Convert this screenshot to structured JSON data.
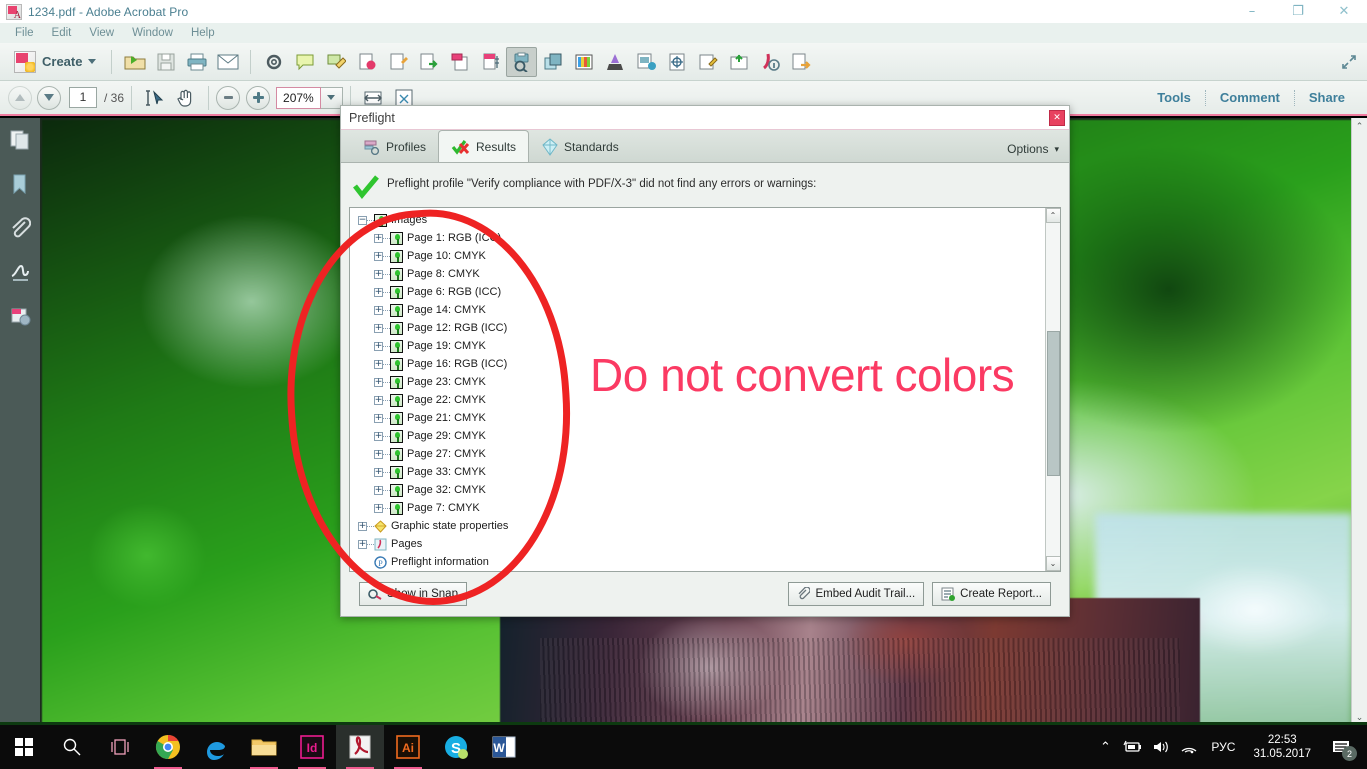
{
  "window": {
    "title": "1234.pdf - Adobe Acrobat Pro",
    "app_icon": "acrobat-icon",
    "minimize": "–",
    "restore": "❐",
    "close": "✕"
  },
  "menubar": {
    "items": [
      "File",
      "Edit",
      "View",
      "Window",
      "Help"
    ]
  },
  "toolbar": {
    "create_label": "Create",
    "create_caret": "▾",
    "icons": [
      "open-file-icon",
      "save-icon",
      "print-icon",
      "email-icon",
      "preferences-gear-icon",
      "sticky-note-icon",
      "highlight-text-icon",
      "attach-file-icon",
      "stamp-icon",
      "export-pdf-icon",
      "combine-files-icon",
      "page-thumbnails-icon",
      "optimize-pdf-icon",
      "preflight-icon",
      "layers-icon",
      "output-preview-icon",
      "ink-manager-icon",
      "print-production-icon",
      "trap-presets-icon",
      "edit-object-icon",
      "save-as-icon",
      "document-info-icon",
      "export-icon"
    ],
    "expand_icon": "expand-toolbar-icon"
  },
  "navbar": {
    "page_up": "page-up-icon",
    "page_down": "page-down-icon",
    "current_page": "1",
    "page_total": "/ 36",
    "select_tool": "select-text-icon",
    "hand_tool": "hand-icon",
    "zoom_out": "zoom-out-icon",
    "zoom_in": "zoom-in-icon",
    "zoom_level": "207%",
    "zoom_caret": "▾",
    "fit_width": "fit-width-icon",
    "fit_page": "fit-page-icon",
    "right_links": [
      "Tools",
      "Comment",
      "Share"
    ]
  },
  "leftrail": {
    "items": [
      "page-thumbnails-icon",
      "bookmarks-icon",
      "attachments-icon",
      "signatures-icon",
      "comments-icon"
    ]
  },
  "document": {
    "watermark_text": "Do not convert colors",
    "watermark_color": "#fb3a63",
    "annotation": "red-ellipse-annotation",
    "annotation_color": "#ee2323",
    "scroll_up": "⌃",
    "scroll_down": "⌄"
  },
  "dialog": {
    "title": "Preflight",
    "close_label": "✕",
    "tabs": [
      {
        "label": "Profiles",
        "icon": "profiles-icon",
        "selected": false
      },
      {
        "label": "Results",
        "icon": "results-check-icon",
        "selected": true
      },
      {
        "label": "Standards",
        "icon": "standards-icon",
        "selected": false
      }
    ],
    "options_label": "Options",
    "options_caret": "▾",
    "status_icon": "green-check-icon",
    "status_text": "Preflight profile \"Verify compliance with PDF/X-3\" did not find any errors or warnings:",
    "tree": [
      {
        "label": "Images",
        "indent": 0,
        "expander": "−",
        "icon": "image-icon"
      },
      {
        "label": "Page 1: RGB (ICC)",
        "indent": 1,
        "expander": "+",
        "icon": "image-icon"
      },
      {
        "label": "Page 10: CMYK",
        "indent": 1,
        "expander": "+",
        "icon": "image-icon"
      },
      {
        "label": "Page 8: CMYK",
        "indent": 1,
        "expander": "+",
        "icon": "image-icon"
      },
      {
        "label": "Page 6: RGB (ICC)",
        "indent": 1,
        "expander": "+",
        "icon": "image-icon"
      },
      {
        "label": "Page 14: CMYK",
        "indent": 1,
        "expander": "+",
        "icon": "image-icon"
      },
      {
        "label": "Page 12: RGB (ICC)",
        "indent": 1,
        "expander": "+",
        "icon": "image-icon"
      },
      {
        "label": "Page 19: CMYK",
        "indent": 1,
        "expander": "+",
        "icon": "image-icon"
      },
      {
        "label": "Page 16: RGB (ICC)",
        "indent": 1,
        "expander": "+",
        "icon": "image-icon"
      },
      {
        "label": "Page 23: CMYK",
        "indent": 1,
        "expander": "+",
        "icon": "image-icon"
      },
      {
        "label": "Page 22: CMYK",
        "indent": 1,
        "expander": "+",
        "icon": "image-icon"
      },
      {
        "label": "Page 21: CMYK",
        "indent": 1,
        "expander": "+",
        "icon": "image-icon"
      },
      {
        "label": "Page 29: CMYK",
        "indent": 1,
        "expander": "+",
        "icon": "image-icon"
      },
      {
        "label": "Page 27: CMYK",
        "indent": 1,
        "expander": "+",
        "icon": "image-icon"
      },
      {
        "label": "Page 33: CMYK",
        "indent": 1,
        "expander": "+",
        "icon": "image-icon"
      },
      {
        "label": "Page 32: CMYK",
        "indent": 1,
        "expander": "+",
        "icon": "image-icon"
      },
      {
        "label": "Page 7: CMYK",
        "indent": 1,
        "expander": "+",
        "icon": "image-icon"
      },
      {
        "label": "Graphic state properties",
        "indent": 0,
        "expander": "+",
        "icon": "graphic-state-icon"
      },
      {
        "label": "Pages",
        "indent": 0,
        "expander": "+",
        "icon": "pages-icon"
      },
      {
        "label": "Preflight information",
        "indent": 0,
        "expander": "",
        "icon": "preflight-info-icon"
      }
    ],
    "scroll_up": "⌃",
    "scroll_down": "⌄",
    "footer": {
      "snap_label": "Show in Snap",
      "snap_icon": "snap-icon",
      "embed_label": "Embed Audit Trail...",
      "embed_icon": "paperclip-icon",
      "report_label": "Create Report...",
      "report_icon": "report-icon"
    }
  },
  "taskbar": {
    "start_icon": "windows-start-icon",
    "search_icon": "search-icon",
    "taskview_icon": "task-view-icon",
    "apps": [
      {
        "name": "chrome-icon",
        "label": "Chrome",
        "active": false
      },
      {
        "name": "edge-icon",
        "label": "Edge",
        "active": false
      },
      {
        "name": "file-explorer-icon",
        "label": "File Explorer",
        "active": false
      },
      {
        "name": "indesign-icon",
        "label": "Id",
        "active": false
      },
      {
        "name": "acrobat-icon",
        "label": "Acrobat",
        "active": true
      },
      {
        "name": "illustrator-icon",
        "label": "Ai",
        "active": false
      },
      {
        "name": "skype-icon",
        "label": "Skype",
        "active": false
      },
      {
        "name": "word-icon",
        "label": "W",
        "active": false
      }
    ],
    "tray": {
      "chevron": "⌃",
      "battery_icon": "battery-icon",
      "volume_icon": "volume-icon",
      "wifi_icon": "wifi-icon",
      "language": "РУС",
      "time": "22:53",
      "date": "31.05.2017",
      "notifications_icon": "notifications-icon",
      "notifications_count": "2"
    }
  }
}
